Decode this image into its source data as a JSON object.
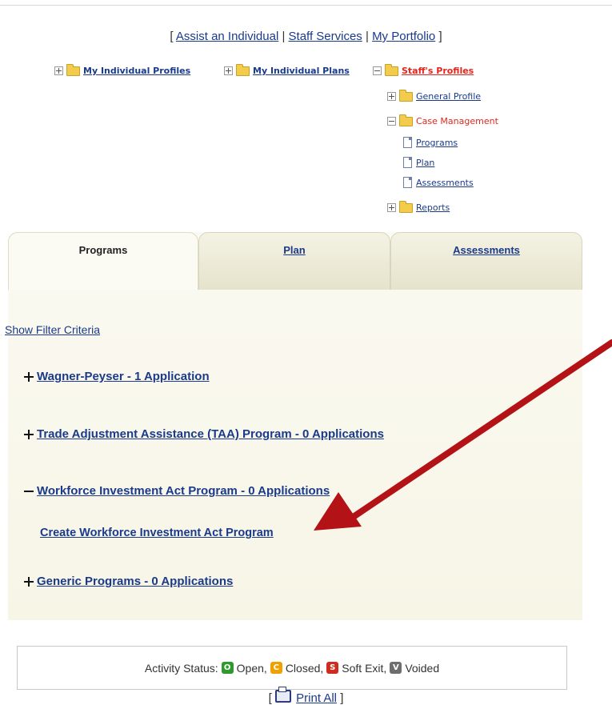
{
  "top_nav": {
    "open_bracket": "[",
    "close_bracket": "]",
    "links": [
      "Assist an Individual",
      "Staff Services",
      "My Portfolio"
    ],
    "separator": "|"
  },
  "tree": {
    "my_individual_profiles": "My Individual Profiles",
    "my_individual_plans": "My Individual Plans",
    "staffs_profiles": "Staff's Profiles",
    "general_profile": "General Profile",
    "case_management": "Case Management",
    "programs": "Programs",
    "plan": "Plan",
    "assessments": "Assessments",
    "reports": "Reports"
  },
  "tabs": {
    "programs": "Programs",
    "plan": "Plan",
    "assessments": "Assessments"
  },
  "filter_link": "Show Filter Criteria",
  "programs": [
    {
      "label": "Wagner-Peyser - 1 Application",
      "expanded": false
    },
    {
      "label": "Trade Adjustment Assistance (TAA) Program - 0 Applications",
      "expanded": false
    },
    {
      "label": "Workforce Investment Act Program - 0 Applications",
      "expanded": true
    },
    {
      "label": "Generic Programs - 0 Applications",
      "expanded": false
    }
  ],
  "create_link": "Create Workforce Investment Act Program",
  "activity_status": {
    "label": "Activity Status:",
    "items": [
      {
        "letter": "O",
        "text": "Open,",
        "color": "#2e9a2e"
      },
      {
        "letter": "C",
        "text": "Closed,",
        "color": "#f0a100"
      },
      {
        "letter": "S",
        "text": "Soft Exit,",
        "color": "#d12a1f"
      },
      {
        "letter": "V",
        "text": "Voided",
        "color": "#6e6e6e"
      }
    ]
  },
  "print": {
    "open_bracket": "[",
    "label": "Print All",
    "close_bracket": "]"
  },
  "annotation_arrow_color": "#b31217"
}
